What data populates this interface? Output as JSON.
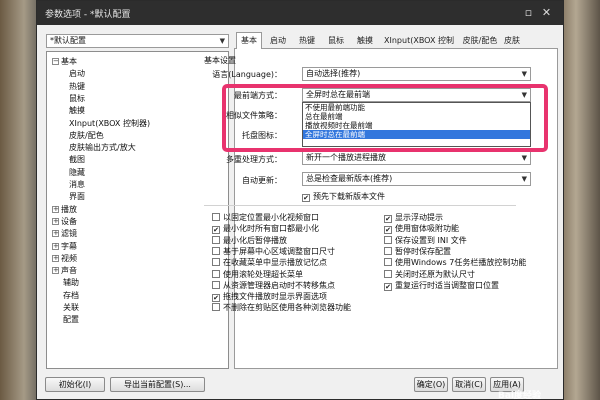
{
  "window": {
    "title": "参数选项 - *默认配置",
    "close_icon": "close-icon",
    "restore_icon": "restore-icon"
  },
  "profile": {
    "selected": "*默认配置"
  },
  "tree": [
    {
      "label": "基本",
      "expanded": true,
      "level": 0
    },
    {
      "label": "启动",
      "level": 1
    },
    {
      "label": "热键",
      "level": 1
    },
    {
      "label": "鼠标",
      "level": 1
    },
    {
      "label": "触摸",
      "level": 1
    },
    {
      "label": "XInput(XBOX 控制器)",
      "level": 1
    },
    {
      "label": "皮肤/配色",
      "level": 1
    },
    {
      "label": "皮肤输出方式/放大",
      "level": 1
    },
    {
      "label": "截图",
      "level": 1
    },
    {
      "label": "隐藏",
      "level": 1
    },
    {
      "label": "消息",
      "level": 1
    },
    {
      "label": "界面",
      "level": 1
    },
    {
      "label": "播放",
      "level": 0,
      "expanded": false
    },
    {
      "label": "设备",
      "level": 0,
      "expanded": false
    },
    {
      "label": "滤镜",
      "level": 0,
      "expanded": false
    },
    {
      "label": "字幕",
      "level": 0,
      "expanded": false
    },
    {
      "label": "视频",
      "level": 0,
      "expanded": false
    },
    {
      "label": "声音",
      "level": 0,
      "expanded": false
    },
    {
      "label": "辅助",
      "level": 0
    },
    {
      "label": "存档",
      "level": 0
    },
    {
      "label": "关联",
      "level": 0
    },
    {
      "label": "配置",
      "level": 0
    }
  ],
  "tabs": [
    "基本",
    "启动",
    "热键",
    "鼠标",
    "触摸",
    "XInput(XBOX 控制器)",
    "皮肤/配色",
    "皮肤"
  ],
  "active_tab": 0,
  "section_title": "基本设置",
  "fields": {
    "language_label": "语言(Language)：",
    "language_value": "自动选择(推荐)",
    "topmost_label": "最前端方式：",
    "topmost_value": "全屏时总在最前端",
    "similar_label": "相似文件策略：",
    "tray_label": "托盘图标：",
    "multi_label": "多重处理方式：",
    "multi_value": "新开一个播放进程播放",
    "update_label": "自动更新：",
    "update_value": "总是检查最新版本(推荐)",
    "predownload": "预先下载新版本文件"
  },
  "dropdown_options": [
    "不使用最前端功能",
    "总在最前端",
    "播放视频时在最前端",
    "全屏时总在最前端"
  ],
  "dropdown_selected": 3,
  "checkboxes_left": [
    {
      "label": "以固定位置最小化视频窗口",
      "checked": false
    },
    {
      "label": "最小化时所有窗口都最小化",
      "checked": true
    },
    {
      "label": "最小化后暂停播放",
      "checked": false
    },
    {
      "label": "基于屏幕中心区域调整窗口尺寸",
      "checked": false
    },
    {
      "label": "在收藏菜单中显示播放记忆点",
      "checked": false
    },
    {
      "label": "使用滚轮处理超长菜单",
      "checked": false
    },
    {
      "label": "从资源管理器启动时不转移焦点",
      "checked": false
    },
    {
      "label": "拖拽文件播放时显示界面选项",
      "checked": true
    },
    {
      "label": "不删除在剪贴区使用各种浏览器功能",
      "checked": false
    }
  ],
  "checkboxes_right": [
    {
      "label": "显示浮动提示",
      "checked": true
    },
    {
      "label": "使用窗体吸附功能",
      "checked": true
    },
    {
      "label": "保存设置到 INI 文件",
      "checked": false
    },
    {
      "label": "暂停时保存配置",
      "checked": false
    },
    {
      "label": "使用Windows 7任务栏播放控制功能",
      "checked": false
    },
    {
      "label": "关闭时还原为默认尺寸",
      "checked": false
    },
    {
      "label": "重复运行时适当调整窗口位置",
      "checked": true
    }
  ],
  "buttons": {
    "init": "初始化(I)",
    "export": "导出当前配置(S)...",
    "ok": "确定(O)",
    "cancel": "取消(C)",
    "apply": "应用(A)"
  },
  "watermark": "Bai度经验",
  "highlight_color": "#e8336e"
}
